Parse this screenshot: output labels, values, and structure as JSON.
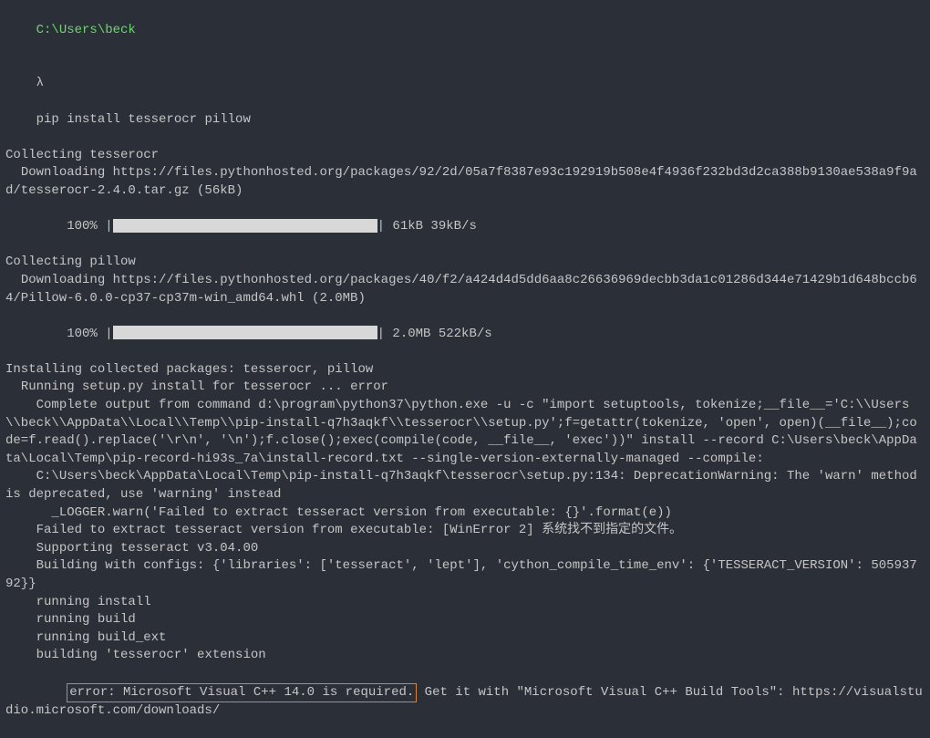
{
  "prompt": {
    "path": "C:\\Users\\beck",
    "symbol": "λ",
    "command": "pip install tesserocr pillow"
  },
  "lines": {
    "collecting_tesserocr": "Collecting tesserocr",
    "download_tesserocr": "  Downloading https://files.pythonhosted.org/packages/92/2d/05a7f8387e93c192919b508e4f4936f232bd3d2ca388b9130ae538a9f9ad/tesserocr-2.4.0.tar.gz (56kB)",
    "progress1_pct": "    100% |",
    "progress1_stats": "| 61kB 39kB/s",
    "collecting_pillow": "Collecting pillow",
    "download_pillow": "  Downloading https://files.pythonhosted.org/packages/40/f2/a424d4d5dd6aa8c26636969decbb3da1c01286d344e71429b1d648bccb64/Pillow-6.0.0-cp37-cp37m-win_amd64.whl (2.0MB)",
    "progress2_pct": "    100% |",
    "progress2_stats": "| 2.0MB 522kB/s",
    "installing": "Installing collected packages: tesserocr, pillow",
    "running_setup": "  Running setup.py install for tesserocr ... error",
    "complete_output": "    Complete output from command d:\\program\\python37\\python.exe -u -c \"import setuptools, tokenize;__file__='C:\\\\Users\\\\beck\\\\AppData\\\\Local\\\\Temp\\\\pip-install-q7h3aqkf\\\\tesserocr\\\\setup.py';f=getattr(tokenize, 'open', open)(__file__);code=f.read().replace('\\r\\n', '\\n');f.close();exec(compile(code, __file__, 'exec'))\" install --record C:\\Users\\beck\\AppData\\Local\\Temp\\pip-record-hi93s_7a\\install-record.txt --single-version-externally-managed --compile:",
    "deprecation": "    C:\\Users\\beck\\AppData\\Local\\Temp\\pip-install-q7h3aqkf\\tesserocr\\setup.py:134: DeprecationWarning: The 'warn' method is deprecated, use 'warning' instead",
    "logger_warn": "      _LOGGER.warn('Failed to extract tesseract version from executable: {}'.format(e))",
    "failed_extract": "    Failed to extract tesseract version from executable: [WinError 2] 系统找不到指定的文件。",
    "supporting": "    Supporting tesseract v3.04.00",
    "building_configs": "    Building with configs: {'libraries': ['tesseract', 'lept'], 'cython_compile_time_env': {'TESSERACT_VERSION': 50593792}}",
    "running_install": "    running install",
    "running_build": "    running build",
    "running_build_ext": "    running build_ext",
    "building_ext": "    building 'tesserocr' extension",
    "error_prefix": "    ",
    "error_highlighted": "error: Microsoft Visual C++ 14.0 is required.",
    "error_suffix": " Get it with \"Microsoft Visual C++ Build Tools\": https://visualstudio.microsoft.com/downloads/"
  },
  "progress_bar_widths": {
    "bar1": "290px",
    "bar2": "290px"
  }
}
